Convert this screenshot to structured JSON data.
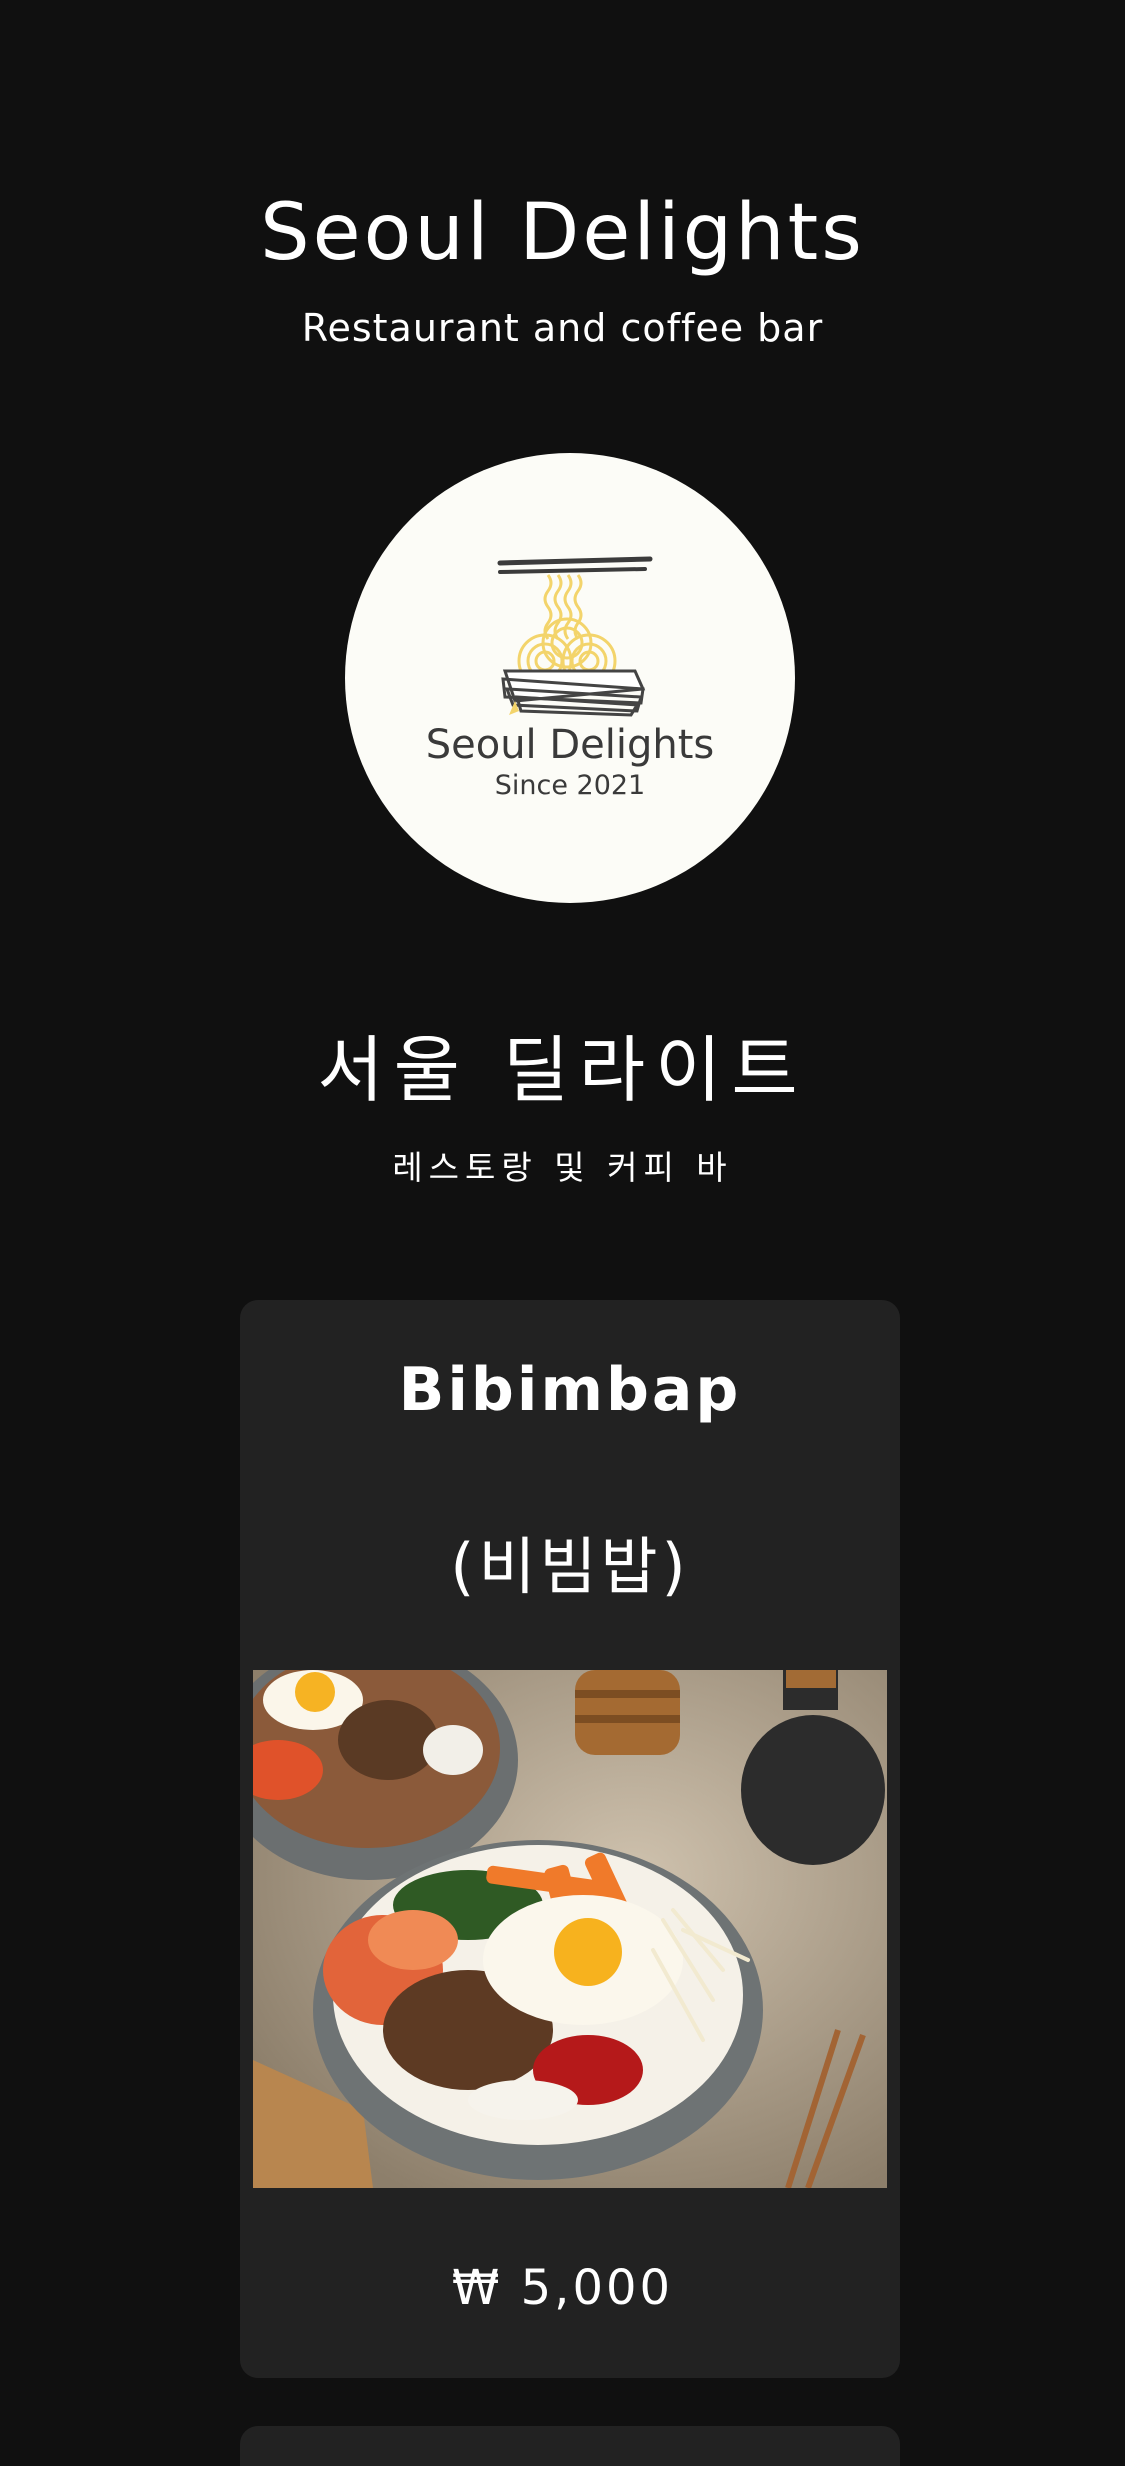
{
  "header": {
    "title": "Seoul Delights",
    "subtitle": "Restaurant and coffee bar"
  },
  "logo": {
    "name": "Seoul Delights",
    "since": "Since 2021",
    "icon": "noodle-bowl-chopsticks-icon"
  },
  "korean": {
    "title": "서울 딜라이트",
    "subtitle": "레스토랑 및 커피 바"
  },
  "menu": {
    "items": [
      {
        "name": "Bibimbap",
        "name_ko": "(비빔밥)",
        "price": "₩ 5,000",
        "photo_icon": "bibimbap-photo"
      }
    ]
  },
  "colors": {
    "background": "#101010",
    "card": "#222222",
    "text": "#ffffff",
    "logo_bg": "#fcfcf7",
    "logo_accent": "#f3d46b"
  }
}
